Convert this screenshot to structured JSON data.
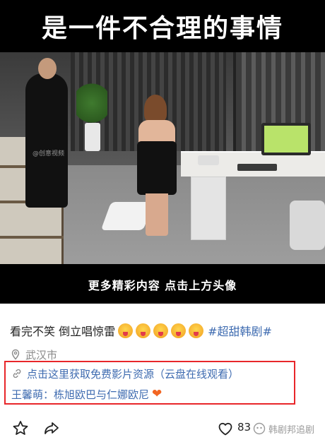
{
  "video": {
    "title": "是一件不合理的事情",
    "watermark": "@创意视频",
    "caption": "更多精彩内容 点击上方头像"
  },
  "post": {
    "text": "看完不笑 倒立唱惊雷",
    "emoji_count": 5,
    "hashtag": "#超甜韩剧#",
    "location": "武汉市",
    "link_text": "点击这里获取免费影片资源（云盘在线观看）",
    "name_text": "王馨萌：栋旭欧巴与仁娜欧尼"
  },
  "actions": {
    "like_count": "83",
    "brand_text": "韩剧邦追剧"
  },
  "colors": {
    "link_blue": "#3e6bb0",
    "highlight_red": "#e8262a",
    "gray_text": "#8a8a8a"
  },
  "icons": {
    "location": "pin-icon",
    "link": "link-icon",
    "star": "star-icon",
    "share": "share-icon",
    "like": "heart-outline-icon",
    "heart_emoji": "orange-heart-emoji"
  }
}
